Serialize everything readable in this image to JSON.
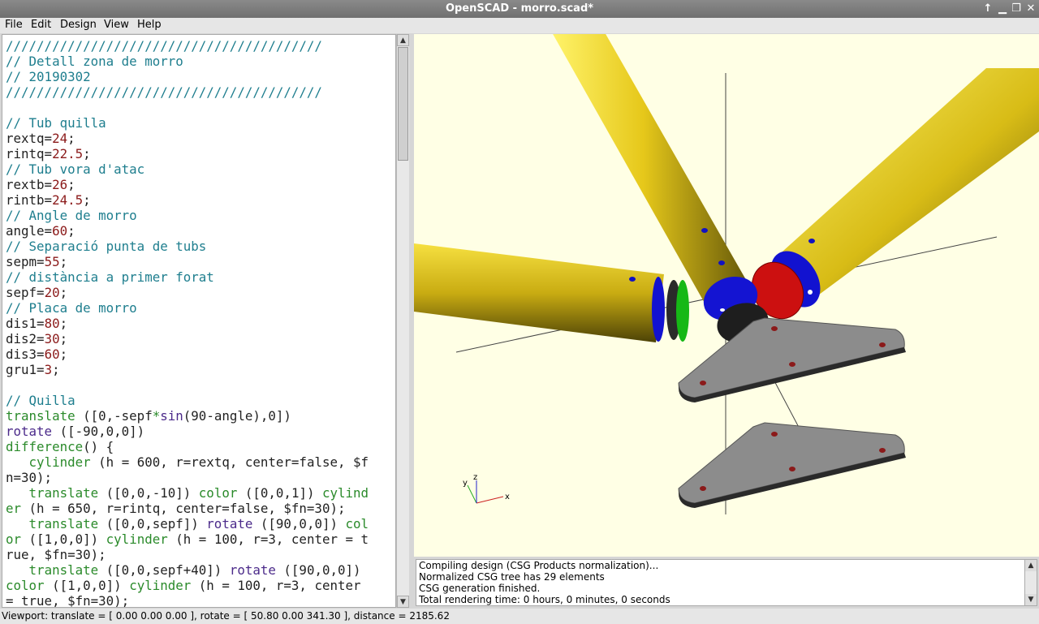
{
  "window": {
    "title": "OpenSCAD - morro.scad*"
  },
  "menu": [
    "File",
    "Edit",
    "Design",
    "View",
    "Help"
  ],
  "editor": {
    "lines": [
      [
        [
          "c",
          "/////////////////////////////////////////"
        ]
      ],
      [
        [
          "c",
          "// Detall zona de morro"
        ]
      ],
      [
        [
          "c",
          "// 20190302"
        ]
      ],
      [
        [
          "c",
          "/////////////////////////////////////////"
        ]
      ],
      [
        [
          "v",
          ""
        ]
      ],
      [
        [
          "c",
          "// Tub quilla"
        ]
      ],
      [
        [
          "v",
          "rextq="
        ],
        [
          "n",
          "24"
        ],
        [
          "v",
          ";"
        ]
      ],
      [
        [
          "v",
          "rintq="
        ],
        [
          "n",
          "22.5"
        ],
        [
          "v",
          ";"
        ]
      ],
      [
        [
          "c",
          "// Tub vora d'atac"
        ]
      ],
      [
        [
          "v",
          "rextb="
        ],
        [
          "n",
          "26"
        ],
        [
          "v",
          ";"
        ]
      ],
      [
        [
          "v",
          "rintb="
        ],
        [
          "n",
          "24.5"
        ],
        [
          "v",
          ";"
        ]
      ],
      [
        [
          "c",
          "// Angle de morro"
        ]
      ],
      [
        [
          "v",
          "angle="
        ],
        [
          "n",
          "60"
        ],
        [
          "v",
          ";"
        ]
      ],
      [
        [
          "c",
          "// Separació punta de tubs"
        ]
      ],
      [
        [
          "v",
          "sepm="
        ],
        [
          "n",
          "55"
        ],
        [
          "v",
          ";"
        ]
      ],
      [
        [
          "c",
          "// distància a primer forat"
        ]
      ],
      [
        [
          "v",
          "sepf="
        ],
        [
          "n",
          "20"
        ],
        [
          "v",
          ";"
        ]
      ],
      [
        [
          "c",
          "// Placa de morro"
        ]
      ],
      [
        [
          "v",
          "dis1="
        ],
        [
          "n",
          "80"
        ],
        [
          "v",
          ";"
        ]
      ],
      [
        [
          "v",
          "dis2="
        ],
        [
          "n",
          "30"
        ],
        [
          "v",
          ";"
        ]
      ],
      [
        [
          "v",
          "dis3="
        ],
        [
          "n",
          "60"
        ],
        [
          "v",
          ";"
        ]
      ],
      [
        [
          "v",
          "gru1="
        ],
        [
          "n",
          "3"
        ],
        [
          "v",
          ";"
        ]
      ],
      [
        [
          "v",
          ""
        ]
      ],
      [
        [
          "c",
          "// Quilla"
        ]
      ],
      [
        [
          "k",
          "translate "
        ],
        [
          "v",
          "([0,-sepf"
        ],
        [
          "k",
          "*"
        ],
        [
          "f",
          "sin"
        ],
        [
          "v",
          "(90-angle),0])"
        ]
      ],
      [
        [
          "f",
          "rotate "
        ],
        [
          "v",
          "([-90,0,0])"
        ]
      ],
      [
        [
          "k",
          "difference"
        ],
        [
          "v",
          "() {"
        ]
      ],
      [
        [
          "v",
          "   "
        ],
        [
          "k",
          "cylinder "
        ],
        [
          "v",
          "(h = 600, r=rextq, center=false, $f"
        ]
      ],
      [
        [
          "v",
          "n=30);"
        ]
      ],
      [
        [
          "v",
          "   "
        ],
        [
          "k",
          "translate "
        ],
        [
          "v",
          "([0,0,-10]) "
        ],
        [
          "k",
          "color "
        ],
        [
          "v",
          "([0,0,1]) "
        ],
        [
          "k",
          "cylind"
        ]
      ],
      [
        [
          "k",
          "er "
        ],
        [
          "v",
          "(h = 650, r=rintq, center=false, $fn=30);"
        ]
      ],
      [
        [
          "v",
          "   "
        ],
        [
          "k",
          "translate "
        ],
        [
          "v",
          "([0,0,sepf]) "
        ],
        [
          "f",
          "rotate "
        ],
        [
          "v",
          "([90,0,0]) "
        ],
        [
          "k",
          "col"
        ]
      ],
      [
        [
          "k",
          "or "
        ],
        [
          "v",
          "([1,0,0]) "
        ],
        [
          "k",
          "cylinder "
        ],
        [
          "v",
          "(h = 100, r=3, center = t"
        ]
      ],
      [
        [
          "v",
          "rue, $fn=30);"
        ]
      ],
      [
        [
          "v",
          "   "
        ],
        [
          "k",
          "translate "
        ],
        [
          "v",
          "([0,0,sepf+40]) "
        ],
        [
          "f",
          "rotate "
        ],
        [
          "v",
          "([90,0,0])"
        ]
      ],
      [
        [
          "k",
          "color "
        ],
        [
          "v",
          "([1,0,0]) "
        ],
        [
          "k",
          "cylinder "
        ],
        [
          "v",
          "(h = 100, r=3, center"
        ]
      ],
      [
        [
          "v",
          "= true, $fn=30);"
        ]
      ]
    ]
  },
  "console": {
    "lines": [
      "Compiling design (CSG Products normalization)...",
      "Normalized CSG tree has 29 elements",
      "CSG generation finished.",
      "Total rendering time: 0 hours, 0 minutes, 0 seconds"
    ]
  },
  "axes": {
    "x": "x",
    "y": "y",
    "z": "z"
  },
  "status": {
    "text": "Viewport: translate = [ 0.00 0.00 0.00 ], rotate = [ 50.80 0.00 341.30 ], distance = 2185.62"
  },
  "colors": {
    "tube": "#f2d61a",
    "plate": "#8c8c8c",
    "blue": "#1414d2",
    "red": "#d01212",
    "green": "#16b816",
    "viewport_bg": "#ffffe5"
  }
}
